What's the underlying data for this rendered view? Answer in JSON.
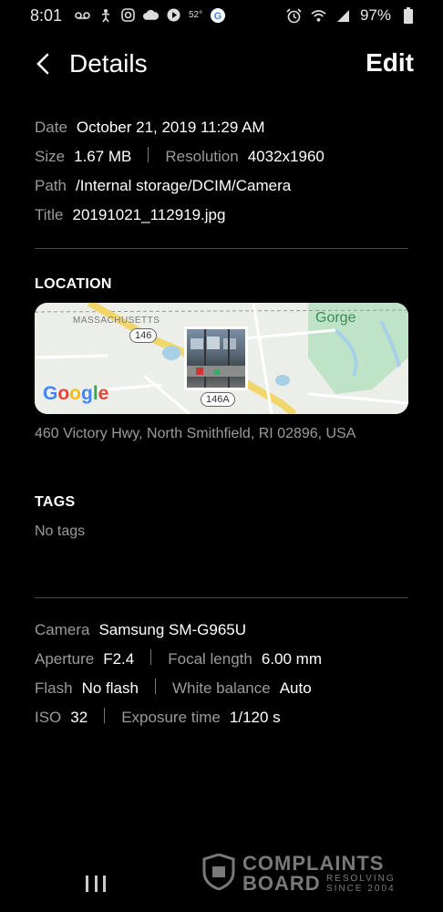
{
  "status_bar": {
    "time": "8:01",
    "temperature": "52°",
    "battery": "97%"
  },
  "header": {
    "title": "Details",
    "edit_label": "Edit"
  },
  "file_info": {
    "date_label": "Date",
    "date_value": "October 21, 2019 11:29 AM",
    "size_label": "Size",
    "size_value": "1.67 MB",
    "resolution_label": "Resolution",
    "resolution_value": "4032x1960",
    "path_label": "Path",
    "path_value": "/Internal storage/DCIM/Camera",
    "title_label": "Title",
    "title_value": "20191021_112919.jpg"
  },
  "location": {
    "section_title": "LOCATION",
    "map_state_label": "MASSACHUSETTS",
    "map_place_label": "Gorge",
    "map_route_1": "146",
    "map_route_2": "146A",
    "map_provider": "Google",
    "address": "460 Victory Hwy, North Smithfield, RI 02896, USA"
  },
  "tags": {
    "section_title": "TAGS",
    "empty_text": "No tags"
  },
  "camera_info": {
    "camera_label": "Camera",
    "camera_value": "Samsung SM-G965U",
    "aperture_label": "Aperture",
    "aperture_value": "F2.4",
    "focal_label": "Focal length",
    "focal_value": "6.00 mm",
    "flash_label": "Flash",
    "flash_value": "No flash",
    "wb_label": "White balance",
    "wb_value": "Auto",
    "iso_label": "ISO",
    "iso_value": "32",
    "exposure_label": "Exposure time",
    "exposure_value": "1/120 s"
  },
  "watermark": {
    "line1": "COMPLAINTS",
    "line2": "BOARD",
    "tagline": "RESOLVING SINCE 2004"
  }
}
